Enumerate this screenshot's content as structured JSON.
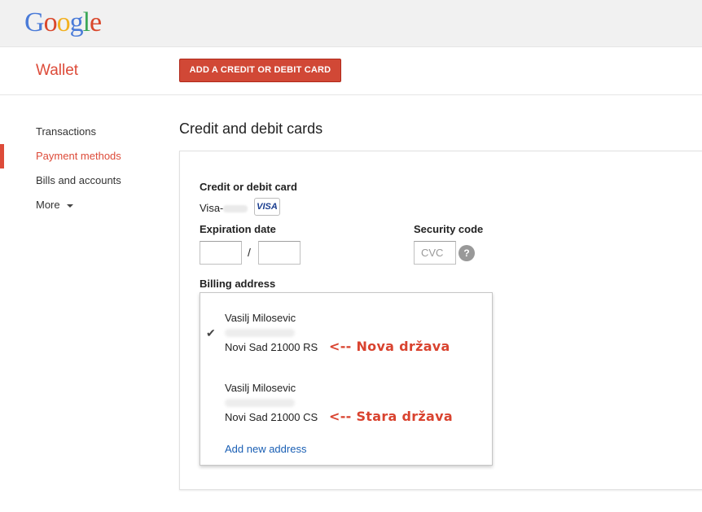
{
  "header": {
    "logo_letters": [
      "G",
      "o",
      "o",
      "g",
      "l",
      "e"
    ]
  },
  "subheader": {
    "app_title": "Wallet",
    "add_card_label": "ADD A CREDIT OR DEBIT CARD"
  },
  "nav": {
    "items": [
      {
        "label": "Transactions",
        "active": false
      },
      {
        "label": "Payment methods",
        "active": true
      },
      {
        "label": "Bills and accounts",
        "active": false
      },
      {
        "label": "More",
        "active": false
      }
    ]
  },
  "main": {
    "section_title": "Credit and debit cards",
    "card_label": "Credit or debit card",
    "card_prefix": "Visa-",
    "card_brand_icon": "VISA",
    "expiration_label": "Expiration date",
    "expiration_separator": "/",
    "security_label": "Security code",
    "cvc_placeholder": "CVC",
    "help_glyph": "?",
    "billing_label": "Billing address"
  },
  "addresses": {
    "items": [
      {
        "name": "Vasilj Milosevic",
        "city_line": "Novi Sad 21000 RS",
        "selected": true,
        "annotation": "<-- Nova država"
      },
      {
        "name": "Vasilj Milosevic",
        "city_line": "Novi Sad 21000 CS",
        "selected": false,
        "annotation": "<-- Stara država"
      }
    ],
    "check_glyph": "✔",
    "add_new_label": "Add new address"
  },
  "colors": {
    "accent": "#dd4b39",
    "button": "#d14836",
    "link": "#1a5fb4",
    "annotation": "#d9432f"
  }
}
